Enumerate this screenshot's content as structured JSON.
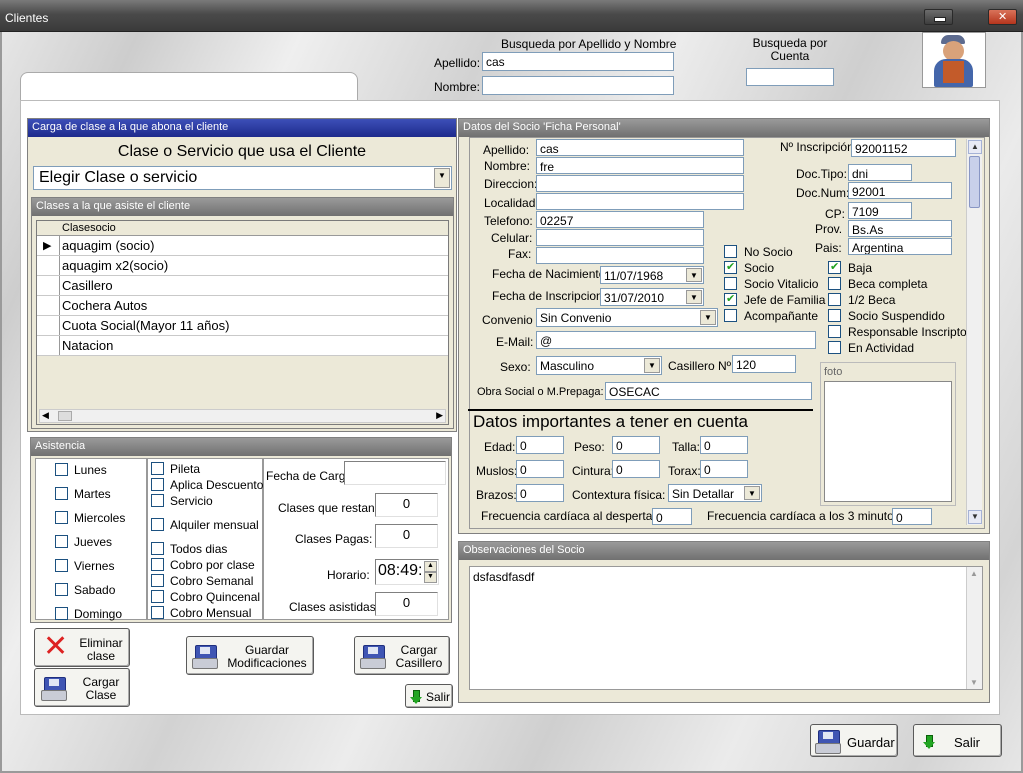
{
  "window": {
    "title": "Clientes"
  },
  "search": {
    "name_heading": "Busqueda por Apellido y Nombre",
    "account_heading": "Busqueda por Cuenta",
    "apellido_label": "Apellido:",
    "apellido_value": "cas",
    "nombre_label": "Nombre:",
    "nombre_value": "",
    "cuenta_value": ""
  },
  "class_panel": {
    "title": "Carga de clase a la que abona el cliente",
    "heading": "Clase o Servicio que usa el Cliente",
    "select_value": "Elegir Clase o servicio",
    "list_title": "Clases a la que asiste el cliente",
    "column_header": "Clasesocio",
    "rows": [
      "aquagim (socio)",
      "aquagim x2(socio)",
      "Casillero",
      "Cochera Autos",
      "Cuota Social(Mayor 11 años)",
      "Natacion"
    ]
  },
  "attendance": {
    "title": "Asistencia",
    "days": [
      "Lunes",
      "Martes",
      "Miercoles",
      "Jueves",
      "Viernes",
      "Sabado",
      "Domingo"
    ],
    "options": [
      "Pileta",
      "Aplica Descuento",
      "Servicio",
      "Alquiler mensual",
      "Todos dias",
      "Cobro por clase",
      "Cobro Semanal",
      "Cobro Quincenal",
      "Cobro Mensual"
    ],
    "fecha_carga_label": "Fecha de Carga",
    "fecha_carga_value": "",
    "restan_label": "Clases que restan:",
    "restan_value": "0",
    "pagas_label": "Clases Pagas:",
    "pagas_value": "0",
    "horario_label": "Horario:",
    "horario_value": "08:49:",
    "asistidas_label": "Clases asistidas:",
    "asistidas_value": "0"
  },
  "left_buttons": {
    "eliminar": "Eliminar clase",
    "guardar_mod": "Guardar Modificaciones",
    "cargar_casillero": "Cargar Casillero",
    "cargar_clase": "Cargar Clase",
    "salir": "Salir"
  },
  "socio": {
    "title": "Datos del Socio 'Ficha Personal'",
    "apellido_label": "Apellido:",
    "apellido": "cas",
    "nombre_label": "Nombre:",
    "nombre": "fre",
    "direccion_label": "Direccion:",
    "direccion": "",
    "localidad_label": "Localidad:",
    "localidad": "",
    "telefono_label": "Telefono:",
    "telefono": "02257",
    "celular_label": "Celular:",
    "celular": "",
    "fax_label": "Fax:",
    "fax": "",
    "inscripcion_label": "Nº Inscripción:",
    "inscripcion": "92001152",
    "doctipo_label": "Doc.Tipo:",
    "doctipo": "dni",
    "docnum_label": "Doc.Num:",
    "docnum": "92001",
    "cp_label": "CP:",
    "cp": "7109",
    "prov_label": "Prov.",
    "prov": "Bs.As",
    "pais_label": "Pais:",
    "pais": "Argentina",
    "nacimiento_label": "Fecha de Nacimiento:",
    "nacimiento": "11/07/1968",
    "inscripcion_fecha_label": "Fecha de Inscripcion:",
    "inscripcion_fecha": "31/07/2010",
    "convenio_label": "Convenio",
    "convenio": "Sin Convenio",
    "email_label": "E-Mail:",
    "email": "@",
    "sexo_label": "Sexo:",
    "sexo": "Masculino",
    "casillero_label": "Casillero Nº:",
    "casillero": "120",
    "obra_label": "Obra Social o M.Prepaga:",
    "obra": "OSECAC",
    "checks_mid": [
      {
        "label": "No Socio",
        "checked": false
      },
      {
        "label": "Socio",
        "checked": true
      },
      {
        "label": "Socio Vitalicio",
        "checked": false
      },
      {
        "label": "Jefe de Familia",
        "checked": true
      },
      {
        "label": "Acompañante",
        "checked": false
      }
    ],
    "checks_right": [
      {
        "label": "Baja",
        "checked": true
      },
      {
        "label": "Beca completa",
        "checked": false
      },
      {
        "label": "1/2 Beca",
        "checked": false
      },
      {
        "label": "Socio Suspendido",
        "checked": false
      },
      {
        "label": "Responsable Inscripto",
        "checked": false
      },
      {
        "label": "En Actividad",
        "checked": false
      }
    ],
    "foto_label": "foto",
    "important_heading": "Datos importantes a tener en cuenta",
    "edad_label": "Edad:",
    "edad": "0",
    "peso_label": "Peso:",
    "peso": "0",
    "talla_label": "Talla:",
    "talla": "0",
    "muslos_label": "Muslos:",
    "muslos": "0",
    "cintura_label": "Cintura:",
    "cintura": "0",
    "torax_label": "Torax:",
    "torax": "0",
    "brazos_label": "Brazos:",
    "brazos": "0",
    "contextura_label": "Contextura física:",
    "contextura": "Sin Detallar",
    "fc_despertar_label": "Frecuencia  cardíaca al despertar:",
    "fc_despertar": "0",
    "fc_3min_label": "Frecuencia cardíaca a los 3 minutos:",
    "fc_3min": "0"
  },
  "observaciones": {
    "title": "Observaciones del Socio",
    "text": "dsfasdfasdf"
  },
  "bottom_buttons": {
    "guardar": "Guardar",
    "salir": "Salir"
  }
}
